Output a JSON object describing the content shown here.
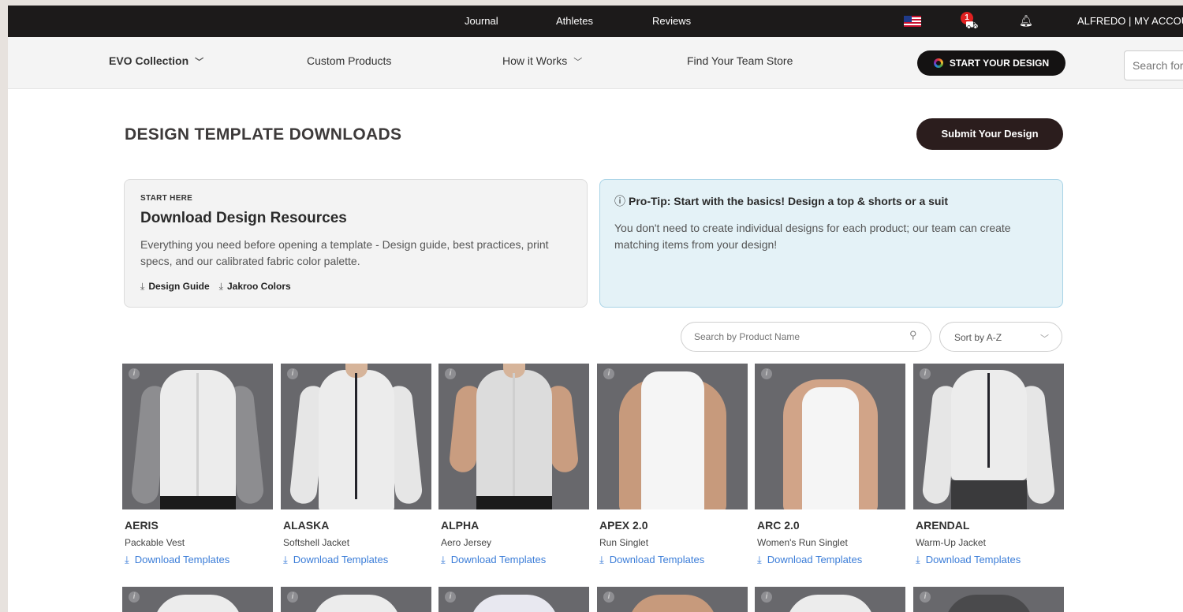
{
  "topbar": {
    "links": [
      "Journal",
      "Athletes",
      "Reviews"
    ],
    "cart_count": "1",
    "account": "ALFREDO | MY ACCOUNT"
  },
  "nav": {
    "items": [
      "EVO Collection",
      "Custom Products",
      "How it Works",
      "Find Your Team Store"
    ],
    "start_design": "START YOUR DESIGN",
    "search_placeholder": "Search for"
  },
  "page": {
    "title": "DESIGN TEMPLATE DOWNLOADS",
    "submit_label": "Submit Your Design"
  },
  "resources": {
    "kicker": "START HERE",
    "title": "Download Design Resources",
    "description": "Everything you need before opening a template - Design guide, best practices, print specs, and our calibrated fabric color palette.",
    "links": [
      "Design Guide",
      "Jakroo Colors"
    ]
  },
  "tip": {
    "title": "Pro-Tip: Start with the basics! Design a top & shorts or a suit",
    "body": "You don't need to create individual designs for each product; our team can create matching items from your design!"
  },
  "filters": {
    "search_placeholder": "Search by Product Name",
    "sort_label": "Sort by A-Z"
  },
  "products": [
    {
      "name": "AERIS",
      "type": "Packable Vest",
      "download": "Download Templates"
    },
    {
      "name": "ALASKA",
      "type": "Softshell Jacket",
      "download": "Download Templates"
    },
    {
      "name": "ALPHA",
      "type": "Aero Jersey",
      "download": "Download Templates"
    },
    {
      "name": "APEX 2.0",
      "type": "Run Singlet",
      "download": "Download Templates"
    },
    {
      "name": "ARC 2.0",
      "type": "Women's Run Singlet",
      "download": "Download Templates"
    },
    {
      "name": "ARENDAL",
      "type": "Warm-Up Jacket",
      "download": "Download Templates"
    }
  ],
  "colors": {
    "topbar_bg": "#1c1a1a",
    "link_blue": "#3b7dd8",
    "tip_bg": "#e4f2f7",
    "card_bg": "#f3f3f3",
    "product_bg": "#68686c"
  }
}
